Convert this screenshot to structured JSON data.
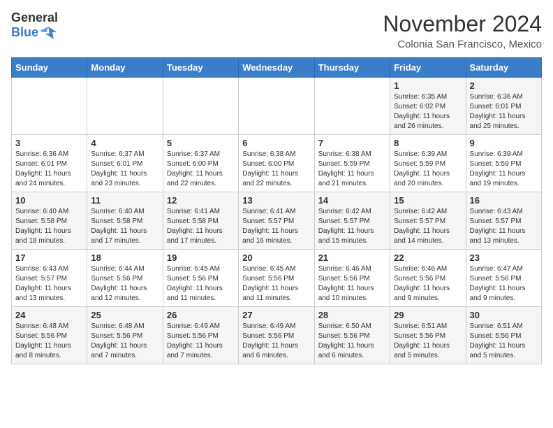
{
  "header": {
    "logo_general": "General",
    "logo_blue": "Blue",
    "title": "November 2024",
    "subtitle": "Colonia San Francisco, Mexico"
  },
  "days_of_week": [
    "Sunday",
    "Monday",
    "Tuesday",
    "Wednesday",
    "Thursday",
    "Friday",
    "Saturday"
  ],
  "weeks": [
    [
      {
        "day": "",
        "info": ""
      },
      {
        "day": "",
        "info": ""
      },
      {
        "day": "",
        "info": ""
      },
      {
        "day": "",
        "info": ""
      },
      {
        "day": "",
        "info": ""
      },
      {
        "day": "1",
        "info": "Sunrise: 6:35 AM\nSunset: 6:02 PM\nDaylight: 11 hours and 26 minutes."
      },
      {
        "day": "2",
        "info": "Sunrise: 6:36 AM\nSunset: 6:01 PM\nDaylight: 11 hours and 25 minutes."
      }
    ],
    [
      {
        "day": "3",
        "info": "Sunrise: 6:36 AM\nSunset: 6:01 PM\nDaylight: 11 hours and 24 minutes."
      },
      {
        "day": "4",
        "info": "Sunrise: 6:37 AM\nSunset: 6:01 PM\nDaylight: 11 hours and 23 minutes."
      },
      {
        "day": "5",
        "info": "Sunrise: 6:37 AM\nSunset: 6:00 PM\nDaylight: 11 hours and 22 minutes."
      },
      {
        "day": "6",
        "info": "Sunrise: 6:38 AM\nSunset: 6:00 PM\nDaylight: 11 hours and 22 minutes."
      },
      {
        "day": "7",
        "info": "Sunrise: 6:38 AM\nSunset: 5:59 PM\nDaylight: 11 hours and 21 minutes."
      },
      {
        "day": "8",
        "info": "Sunrise: 6:39 AM\nSunset: 5:59 PM\nDaylight: 11 hours and 20 minutes."
      },
      {
        "day": "9",
        "info": "Sunrise: 6:39 AM\nSunset: 5:59 PM\nDaylight: 11 hours and 19 minutes."
      }
    ],
    [
      {
        "day": "10",
        "info": "Sunrise: 6:40 AM\nSunset: 5:58 PM\nDaylight: 11 hours and 18 minutes."
      },
      {
        "day": "11",
        "info": "Sunrise: 6:40 AM\nSunset: 5:58 PM\nDaylight: 11 hours and 17 minutes."
      },
      {
        "day": "12",
        "info": "Sunrise: 6:41 AM\nSunset: 5:58 PM\nDaylight: 11 hours and 17 minutes."
      },
      {
        "day": "13",
        "info": "Sunrise: 6:41 AM\nSunset: 5:57 PM\nDaylight: 11 hours and 16 minutes."
      },
      {
        "day": "14",
        "info": "Sunrise: 6:42 AM\nSunset: 5:57 PM\nDaylight: 11 hours and 15 minutes."
      },
      {
        "day": "15",
        "info": "Sunrise: 6:42 AM\nSunset: 5:57 PM\nDaylight: 11 hours and 14 minutes."
      },
      {
        "day": "16",
        "info": "Sunrise: 6:43 AM\nSunset: 5:57 PM\nDaylight: 11 hours and 13 minutes."
      }
    ],
    [
      {
        "day": "17",
        "info": "Sunrise: 6:43 AM\nSunset: 5:57 PM\nDaylight: 11 hours and 13 minutes."
      },
      {
        "day": "18",
        "info": "Sunrise: 6:44 AM\nSunset: 5:56 PM\nDaylight: 11 hours and 12 minutes."
      },
      {
        "day": "19",
        "info": "Sunrise: 6:45 AM\nSunset: 5:56 PM\nDaylight: 11 hours and 11 minutes."
      },
      {
        "day": "20",
        "info": "Sunrise: 6:45 AM\nSunset: 5:56 PM\nDaylight: 11 hours and 11 minutes."
      },
      {
        "day": "21",
        "info": "Sunrise: 6:46 AM\nSunset: 5:56 PM\nDaylight: 11 hours and 10 minutes."
      },
      {
        "day": "22",
        "info": "Sunrise: 6:46 AM\nSunset: 5:56 PM\nDaylight: 11 hours and 9 minutes."
      },
      {
        "day": "23",
        "info": "Sunrise: 6:47 AM\nSunset: 5:56 PM\nDaylight: 11 hours and 9 minutes."
      }
    ],
    [
      {
        "day": "24",
        "info": "Sunrise: 6:48 AM\nSunset: 5:56 PM\nDaylight: 11 hours and 8 minutes."
      },
      {
        "day": "25",
        "info": "Sunrise: 6:48 AM\nSunset: 5:56 PM\nDaylight: 11 hours and 7 minutes."
      },
      {
        "day": "26",
        "info": "Sunrise: 6:49 AM\nSunset: 5:56 PM\nDaylight: 11 hours and 7 minutes."
      },
      {
        "day": "27",
        "info": "Sunrise: 6:49 AM\nSunset: 5:56 PM\nDaylight: 11 hours and 6 minutes."
      },
      {
        "day": "28",
        "info": "Sunrise: 6:50 AM\nSunset: 5:56 PM\nDaylight: 11 hours and 6 minutes."
      },
      {
        "day": "29",
        "info": "Sunrise: 6:51 AM\nSunset: 5:56 PM\nDaylight: 11 hours and 5 minutes."
      },
      {
        "day": "30",
        "info": "Sunrise: 6:51 AM\nSunset: 5:56 PM\nDaylight: 11 hours and 5 minutes."
      }
    ]
  ]
}
